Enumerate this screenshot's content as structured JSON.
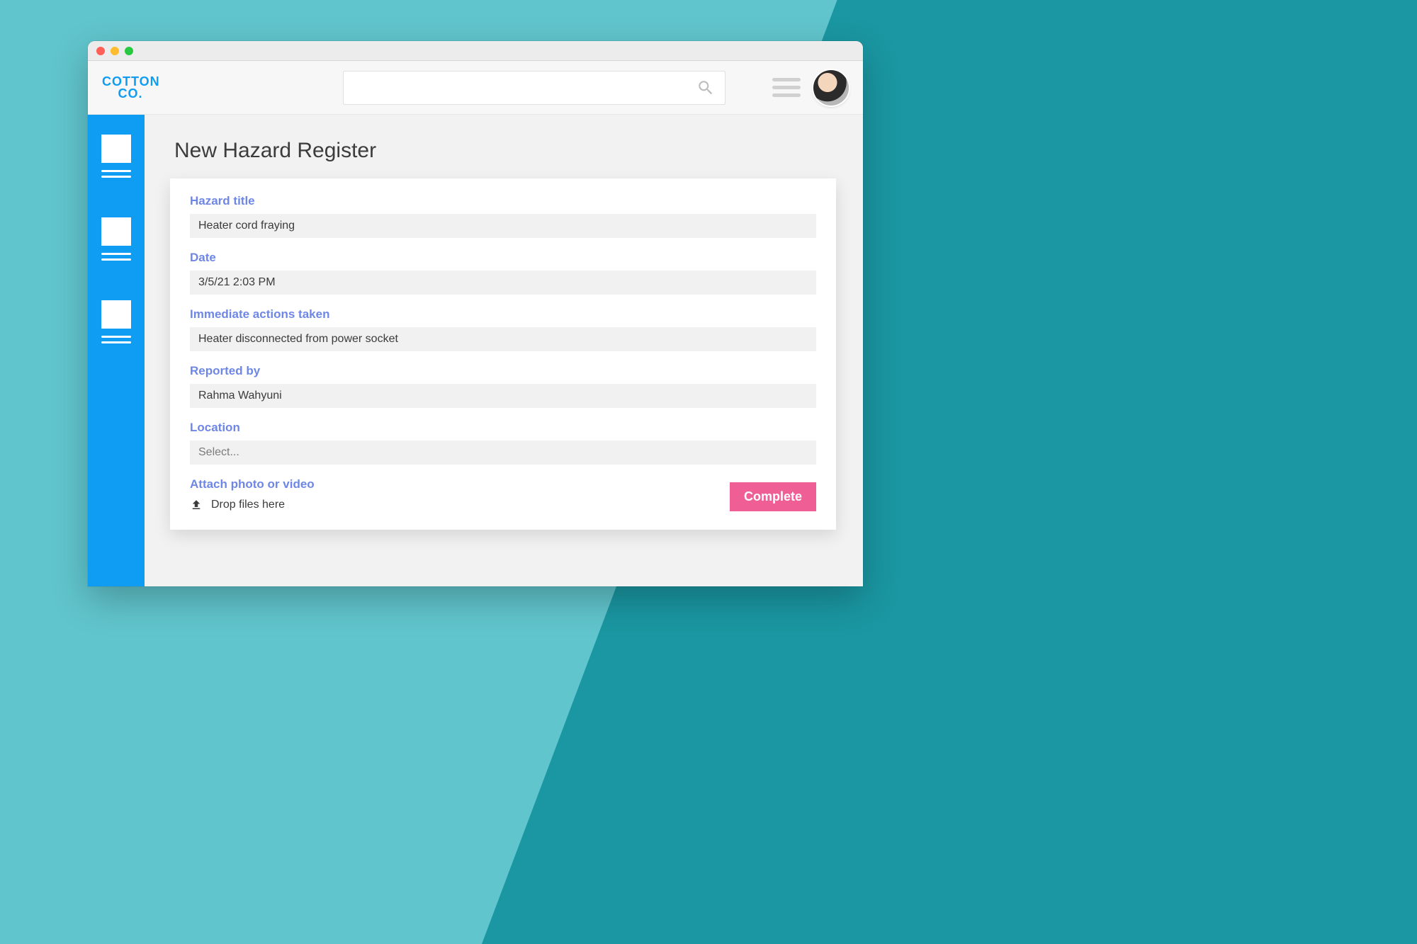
{
  "brand": {
    "line1": "COTTON",
    "line2": "CO."
  },
  "page": {
    "title": "New Hazard Register"
  },
  "form": {
    "hazard_title": {
      "label": "Hazard title",
      "value": "Heater cord fraying"
    },
    "date": {
      "label": "Date",
      "value": "3/5/21 2:03 PM"
    },
    "actions": {
      "label": "Immediate actions taken",
      "value": "Heater disconnected from power socket"
    },
    "reported_by": {
      "label": "Reported by",
      "value": "Rahma Wahyuni"
    },
    "location": {
      "label": "Location",
      "value": "Select..."
    },
    "attach": {
      "label": "Attach photo or video",
      "drop_text": "Drop files here"
    }
  },
  "buttons": {
    "complete": "Complete"
  }
}
